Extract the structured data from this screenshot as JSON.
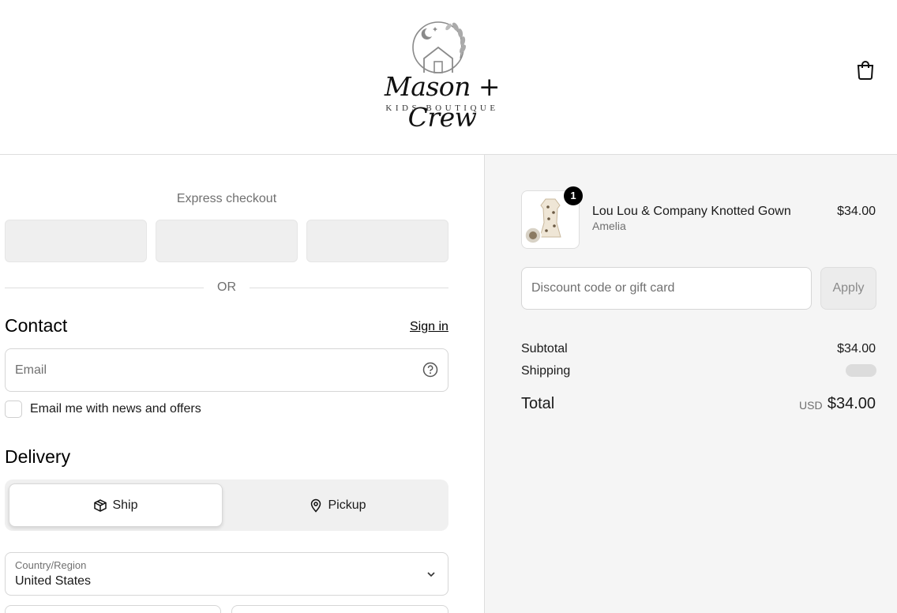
{
  "brand": {
    "name": "Mason + Crew",
    "tagline": "KIDS BOUTIQUE"
  },
  "header": {
    "cart_icon": "shopping-bag-icon"
  },
  "express": {
    "title": "Express checkout",
    "or_text": "OR"
  },
  "contact": {
    "title": "Contact",
    "sign_in": "Sign in",
    "email_placeholder": "Email",
    "newsletter_label": "Email me with news and offers"
  },
  "delivery": {
    "title": "Delivery",
    "options": [
      {
        "label": "Ship",
        "icon": "box-icon",
        "selected": true
      },
      {
        "label": "Pickup",
        "icon": "location-pin-icon",
        "selected": false
      }
    ],
    "country_label": "Country/Region",
    "country_value": "United States"
  },
  "summary": {
    "item": {
      "name": "Lou Lou & Company Knotted Gown",
      "variant": "Amelia",
      "price": "$34.00",
      "quantity": "1"
    },
    "discount_placeholder": "Discount code or gift card",
    "apply_label": "Apply",
    "subtotal_label": "Subtotal",
    "subtotal_value": "$34.00",
    "shipping_label": "Shipping",
    "total_label": "Total",
    "total_currency": "USD",
    "total_value": "$34.00"
  },
  "colors": {
    "accent": "#000000",
    "summary_bg": "#f5f5f5",
    "muted_text": "#707070"
  }
}
